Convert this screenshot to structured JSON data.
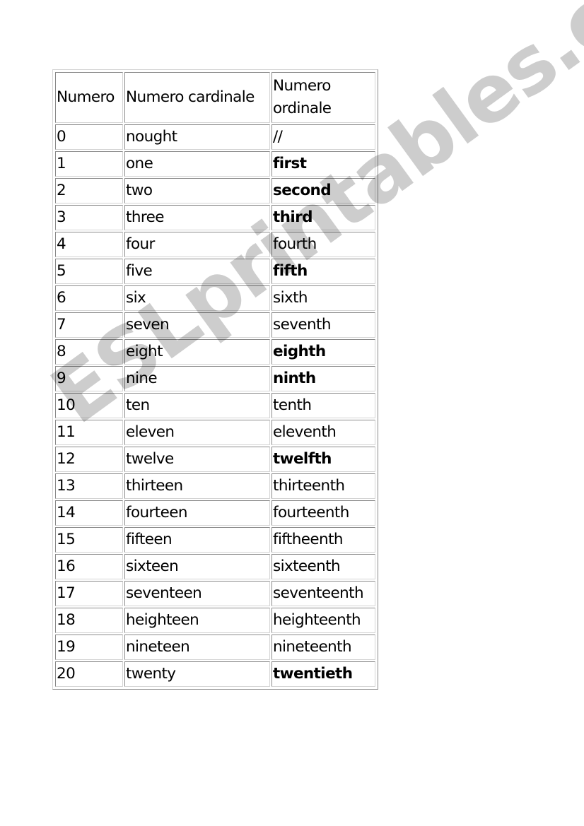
{
  "table": {
    "headers": [
      "Numero",
      "Numero cardinale",
      "Numero ordinale"
    ],
    "rows": [
      {
        "number": "0",
        "cardinal": "nought",
        "ordinal": "//",
        "ordinal_bold": false
      },
      {
        "number": "1",
        "cardinal": "one",
        "ordinal": "first",
        "ordinal_bold": true
      },
      {
        "number": "2",
        "cardinal": "two",
        "ordinal": "second",
        "ordinal_bold": true
      },
      {
        "number": "3",
        "cardinal": "three",
        "ordinal": "third",
        "ordinal_bold": true
      },
      {
        "number": "4",
        "cardinal": "four",
        "ordinal": "fourth",
        "ordinal_bold": false
      },
      {
        "number": "5",
        "cardinal": "five",
        "ordinal": "fifth",
        "ordinal_bold": true
      },
      {
        "number": "6",
        "cardinal": "six",
        "ordinal": "sixth",
        "ordinal_bold": false
      },
      {
        "number": "7",
        "cardinal": "seven",
        "ordinal": "seventh",
        "ordinal_bold": false
      },
      {
        "number": "8",
        "cardinal": "eight",
        "ordinal": "eighth",
        "ordinal_bold": true
      },
      {
        "number": "9",
        "cardinal": "nine",
        "ordinal": "ninth",
        "ordinal_bold": true
      },
      {
        "number": "10",
        "cardinal": "ten",
        "ordinal": "tenth",
        "ordinal_bold": false
      },
      {
        "number": "11",
        "cardinal": "eleven",
        "ordinal": "eleventh",
        "ordinal_bold": false
      },
      {
        "number": "12",
        "cardinal": "twelve",
        "ordinal": "twelfth",
        "ordinal_bold": true
      },
      {
        "number": "13",
        "cardinal": "thirteen",
        "ordinal": "thirteenth",
        "ordinal_bold": false
      },
      {
        "number": "14",
        "cardinal": "fourteen",
        "ordinal": "fourteenth",
        "ordinal_bold": false
      },
      {
        "number": "15",
        "cardinal": "fifteen",
        "ordinal": "fiftheenth",
        "ordinal_bold": false
      },
      {
        "number": "16",
        "cardinal": "sixteen",
        "ordinal": "sixteenth",
        "ordinal_bold": false
      },
      {
        "number": "17",
        "cardinal": "seventeen",
        "ordinal": "seventeenth",
        "ordinal_bold": false
      },
      {
        "number": "18",
        "cardinal": "heighteen",
        "ordinal": "heighteenth",
        "ordinal_bold": false
      },
      {
        "number": "19",
        "cardinal": "nineteen",
        "ordinal": "nineteenth",
        "ordinal_bold": false
      },
      {
        "number": "20",
        "cardinal": "twenty",
        "ordinal": "twentieth",
        "ordinal_bold": true
      }
    ]
  },
  "watermark": {
    "text": "ESLprintables.com",
    "color": "#cbcbcb"
  }
}
